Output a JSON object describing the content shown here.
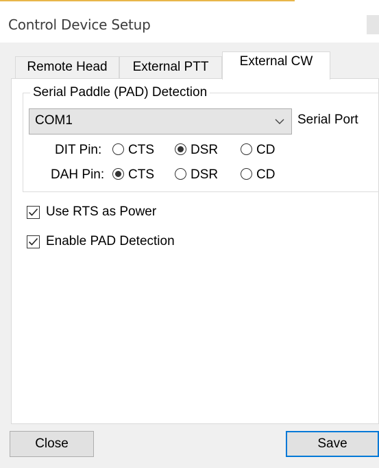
{
  "window": {
    "title": "Control Device Setup"
  },
  "tabs": [
    {
      "label": "Remote Head",
      "active": false
    },
    {
      "label": "External PTT",
      "active": false
    },
    {
      "label": "External CW",
      "active": true
    }
  ],
  "serial_paddle": {
    "group_title": "Serial Paddle (PAD) Detection",
    "port": {
      "selected": "COM1",
      "label": "Serial Port"
    },
    "dit_pin": {
      "label": "DIT Pin:",
      "options": [
        "CTS",
        "DSR",
        "CD"
      ],
      "selected": "DSR"
    },
    "dah_pin": {
      "label": "DAH Pin:",
      "options": [
        "CTS",
        "DSR",
        "CD"
      ],
      "selected": "CTS"
    }
  },
  "checkboxes": {
    "use_rts": {
      "label": "Use RTS as Power",
      "checked": true
    },
    "enable_pad": {
      "label": "Enable PAD Detection",
      "checked": true
    }
  },
  "buttons": {
    "close": "Close",
    "save": "Save"
  },
  "colors": {
    "accent": "#0078d7",
    "window_background": "#f0f0f0",
    "panel_background": "#ffffff"
  },
  "icons": {
    "dropdown": "chevron-down-icon",
    "check": "checkmark-icon"
  }
}
